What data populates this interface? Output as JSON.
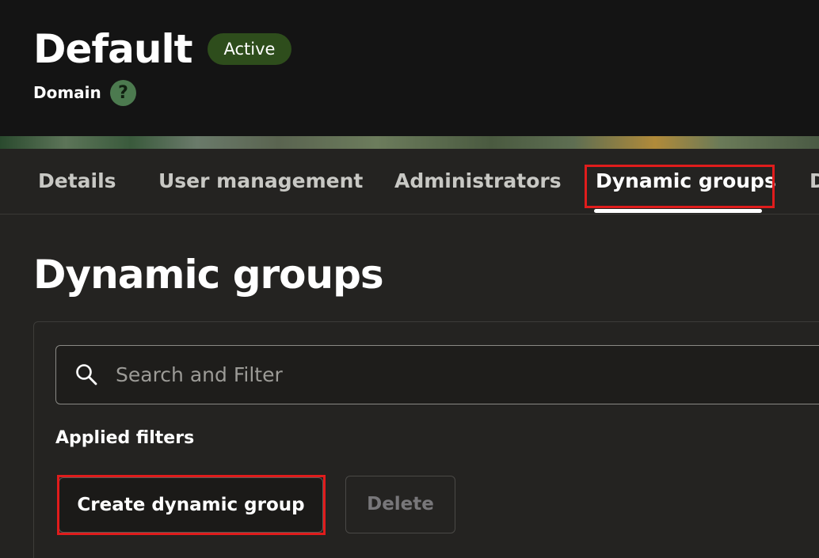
{
  "header": {
    "title": "Default",
    "status_badge": "Active",
    "subtitle": "Domain",
    "help_icon_glyph": "?"
  },
  "tabs": [
    {
      "label": "Details",
      "active": false
    },
    {
      "label": "User management",
      "active": false
    },
    {
      "label": "Administrators",
      "active": false
    },
    {
      "label": "Dynamic groups",
      "active": true
    },
    {
      "label": "D",
      "active": false
    }
  ],
  "main": {
    "title": "Dynamic groups",
    "search": {
      "placeholder": "Search and Filter",
      "value": ""
    },
    "applied_filters_label": "Applied filters",
    "create_button": "Create dynamic group",
    "delete_button": "Delete"
  },
  "colors": {
    "header_bg": "#141414",
    "badge_bg": "#2e4d1c",
    "highlight": "#e01c1c",
    "help_icon": "#4c7a4f"
  },
  "icons": {
    "search": "search-icon",
    "help": "help-icon"
  }
}
